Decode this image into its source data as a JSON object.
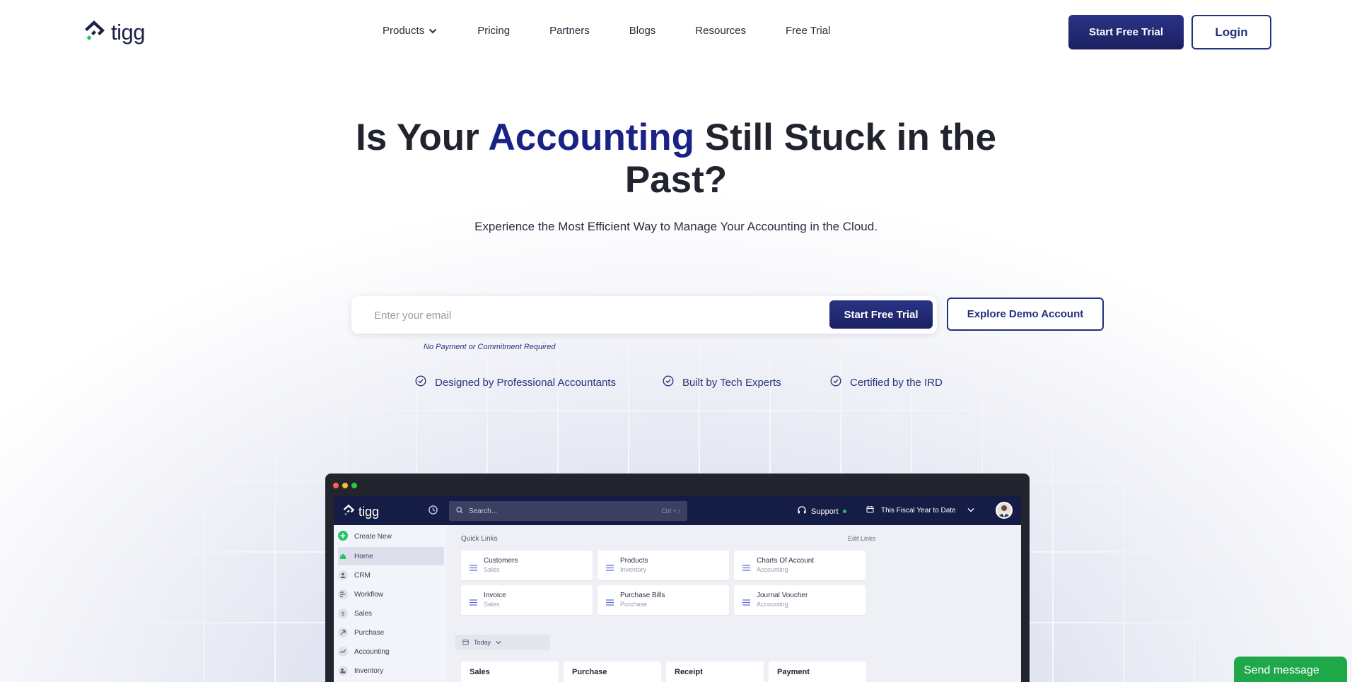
{
  "header": {
    "logo_text": "tigg",
    "nav": [
      {
        "label": "Products",
        "has_dropdown": true
      },
      {
        "label": "Pricing"
      },
      {
        "label": "Partners"
      },
      {
        "label": "Blogs"
      },
      {
        "label": "Resources"
      },
      {
        "label": "Free Trial"
      }
    ],
    "cta_label": "Start Free Trial",
    "login_label": "Login"
  },
  "hero": {
    "title_prefix": "Is Your ",
    "title_accent": "Accounting",
    "title_suffix": " Still Stuck in the Past?",
    "subtitle": "Experience the Most Efficient Way to Manage Your Accounting in the Cloud.",
    "email_placeholder": "Enter your email",
    "email_button": "Start Free Trial",
    "demo_button": "Explore Demo Account",
    "note": "No Payment or Commitment Required",
    "features": [
      "Designed by Professional Accountants",
      "Built by Tech Experts",
      "Certified by the IRD"
    ]
  },
  "app_preview": {
    "logo_text": "tigg",
    "search_placeholder": "Search...",
    "search_shortcut": "Ctrl + /",
    "support_label": "Support",
    "fiscal_label": "This Fiscal Year to Date",
    "sidebar": [
      {
        "label": "Create New",
        "icon": "plus-circle-icon"
      },
      {
        "label": "Home",
        "icon": "home-icon",
        "active": true
      },
      {
        "label": "CRM",
        "icon": "user-icon"
      },
      {
        "label": "Workflow",
        "icon": "workflow-icon"
      },
      {
        "label": "Sales",
        "icon": "dollar-icon"
      },
      {
        "label": "Purchase",
        "icon": "purchase-icon"
      },
      {
        "label": "Accounting",
        "icon": "chart-line-icon"
      },
      {
        "label": "Inventory",
        "icon": "inventory-icon"
      }
    ],
    "quick_links_title": "Quick Links",
    "edit_links_label": "Edit Links",
    "quick_links": [
      {
        "name": "Customers",
        "sub": "Sales"
      },
      {
        "name": "Products",
        "sub": "Inventory"
      },
      {
        "name": "Charts Of Account",
        "sub": "Accounting"
      },
      {
        "name": "Invoice",
        "sub": "Sales"
      },
      {
        "name": "Purchase Bills",
        "sub": "Purchase"
      },
      {
        "name": "Journal Voucher",
        "sub": "Accounting"
      }
    ],
    "date_filter": "Today",
    "summary_cards": [
      "Sales",
      "Purchase",
      "Receipt",
      "Payment"
    ]
  },
  "chat": {
    "label": "Send message"
  },
  "colors": {
    "brand": "#1a2385",
    "button_dark": "#1f2868",
    "chat_green": "#1fa84a",
    "logo_green": "#27c267"
  }
}
